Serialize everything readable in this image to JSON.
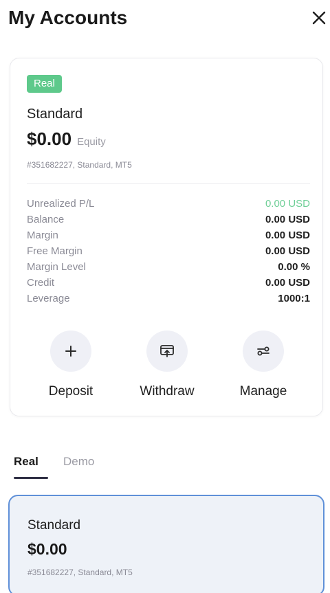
{
  "header": {
    "title": "My Accounts",
    "close_icon": "close-icon"
  },
  "summary": {
    "badge": "Real",
    "account_type": "Standard",
    "equity_amount": "$0.00",
    "equity_label": "Equity",
    "account_meta": "#351682227, Standard, MT5",
    "stats": [
      {
        "label": "Unrealized P/L",
        "value": "0.00 USD",
        "positive": true
      },
      {
        "label": "Balance",
        "value": "0.00 USD",
        "positive": false
      },
      {
        "label": "Margin",
        "value": "0.00 USD",
        "positive": false
      },
      {
        "label": "Free Margin",
        "value": "0.00 USD",
        "positive": false
      },
      {
        "label": "Margin Level",
        "value": "0.00 %",
        "positive": false
      },
      {
        "label": "Credit",
        "value": "0.00 USD",
        "positive": false
      },
      {
        "label": "Leverage",
        "value": "1000:1",
        "positive": false
      }
    ],
    "actions": [
      {
        "label": "Deposit",
        "icon": "plus-icon"
      },
      {
        "label": "Withdraw",
        "icon": "withdraw-icon"
      },
      {
        "label": "Manage",
        "icon": "sliders-icon"
      }
    ]
  },
  "tabs": [
    {
      "label": "Real",
      "active": true
    },
    {
      "label": "Demo",
      "active": false
    }
  ],
  "account_list": [
    {
      "type": "Standard",
      "amount": "$0.00",
      "meta": "#351682227, Standard, MT5"
    }
  ],
  "colors": {
    "badge_green": "#5ec98b",
    "positive_green": "#6fcf97",
    "selected_border": "#5f90d8",
    "selected_bg": "#eef2f8",
    "icon_circle_bg": "#eff0f6"
  }
}
